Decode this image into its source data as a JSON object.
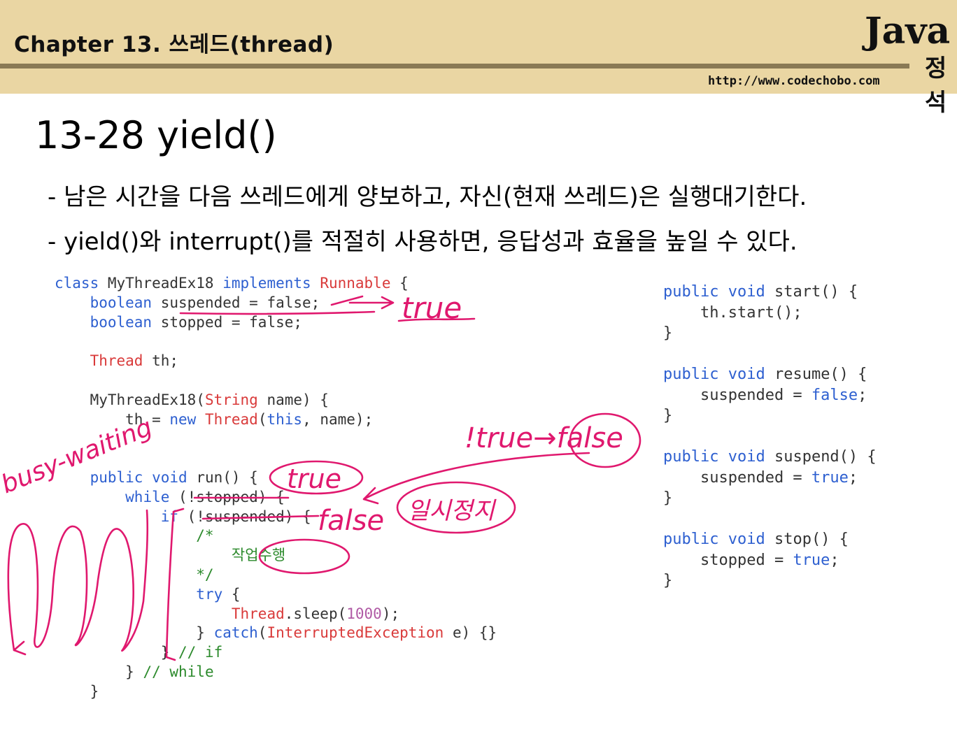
{
  "header": {
    "chapter": "Chapter 13. 쓰레드(thread)",
    "logo_text": "Java",
    "logo_sub": "정석",
    "url": "http://www.codechobo.com"
  },
  "slide": {
    "title": "13-28 yield()",
    "bullets": [
      "- 남은 시간을 다음 쓰레드에게 양보하고, 자신(현재 쓰레드)은 실행대기한다.",
      "- yield()와 interrupt()를 적절히 사용하면, 응답성과 효율을 높일 수 있다."
    ]
  },
  "code_left": {
    "l1": [
      "class",
      " MyThreadEx18 ",
      "implements",
      " ",
      "Runnable",
      " {"
    ],
    "l2": [
      "    ",
      "boolean",
      " suspended = false;"
    ],
    "l3": [
      "    ",
      "boolean",
      " stopped = false;"
    ],
    "l5": [
      "    ",
      "Thread",
      " th;"
    ],
    "l7": [
      "    MyThreadEx18(",
      "String",
      " name) {"
    ],
    "l8": [
      "        th = ",
      "new",
      " ",
      "Thread",
      "(",
      "this",
      ", name);"
    ],
    "l11": [
      "    ",
      "public",
      " ",
      "void",
      " run() {"
    ],
    "l12": [
      "        ",
      "while",
      " (!stopped) {"
    ],
    "l13": [
      "            ",
      "if",
      " (!suspended) {"
    ],
    "l14": [
      "                /*"
    ],
    "l15": [
      "                    ",
      "작업수행"
    ],
    "l16": [
      "                */"
    ],
    "l17": [
      "                ",
      "try",
      " {"
    ],
    "l18": [
      "                    ",
      "Thread",
      ".sleep(",
      "1000",
      ");"
    ],
    "l19": [
      "                } ",
      "catch",
      "(",
      "InterruptedException",
      " e) {}"
    ],
    "l20": [
      "            } ",
      "// if"
    ],
    "l21": [
      "        } ",
      "// while"
    ],
    "l22": [
      "    }"
    ]
  },
  "code_right": {
    "start": [
      "public",
      " ",
      "void",
      " start() {",
      "    th.start();",
      "}"
    ],
    "resume": [
      "public",
      " ",
      "void",
      " resume() {",
      "    suspended = ",
      "false",
      ";",
      "}"
    ],
    "suspend": [
      "public",
      " ",
      "void",
      " suspend() {",
      "    suspended = ",
      "true",
      ";",
      "}"
    ],
    "stop": [
      "public",
      " ",
      "void",
      " stop() {",
      "    stopped = ",
      "true",
      ";",
      "}"
    ]
  },
  "annotations": {
    "true_top": "true",
    "busy_waiting": "busy-waiting",
    "not_true_false": "!true→false",
    "true_run": "true",
    "false_if": "false",
    "pause": "일시정지"
  },
  "colors": {
    "header_bg": "#ead6a3",
    "header_rule": "#8a7a55",
    "keyword": "#2d5fd0",
    "type": "#d93a3a",
    "comment": "#2c8a2c",
    "number": "#b05aa5",
    "ink": "#e0186e"
  }
}
